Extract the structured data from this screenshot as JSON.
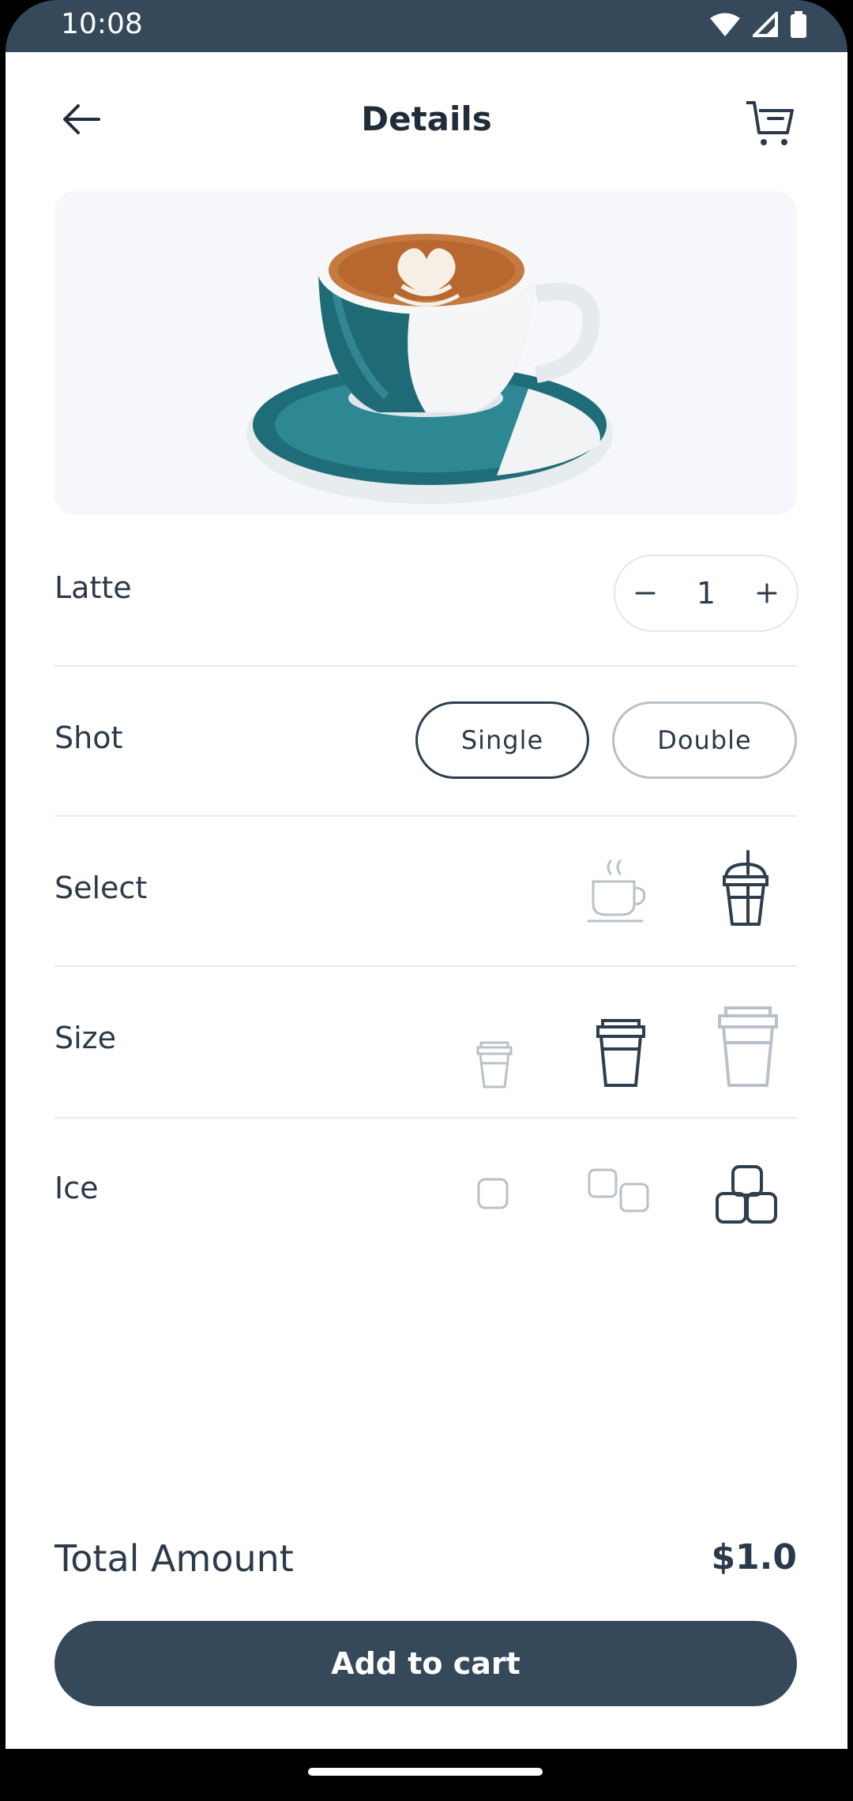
{
  "status_bar": {
    "time": "10:08"
  },
  "header": {
    "title": "Details"
  },
  "product": {
    "name": "Latte",
    "quantity": "1"
  },
  "shot": {
    "label": "Shot",
    "options": [
      "Single",
      "Double"
    ],
    "selected": "Single"
  },
  "select": {
    "label": "Select",
    "options": [
      "hot-cup-icon",
      "iced-cup-icon"
    ],
    "selected": "iced-cup-icon"
  },
  "size": {
    "label": "Size",
    "options": [
      "small-cup-icon",
      "medium-cup-icon",
      "large-cup-icon"
    ],
    "selected": "medium-cup-icon"
  },
  "ice": {
    "label": "Ice",
    "options": [
      "one-ice-icon",
      "two-ice-icon",
      "three-ice-icon"
    ],
    "selected": "three-ice-icon"
  },
  "total": {
    "label": "Total Amount",
    "value": "$1.0"
  },
  "cta": {
    "label": "Add to cart"
  },
  "colors": {
    "primary": "#36495b",
    "muted": "#b8c1c9",
    "text": "#2a3a4a",
    "hero_bg": "#f6f7fb"
  }
}
